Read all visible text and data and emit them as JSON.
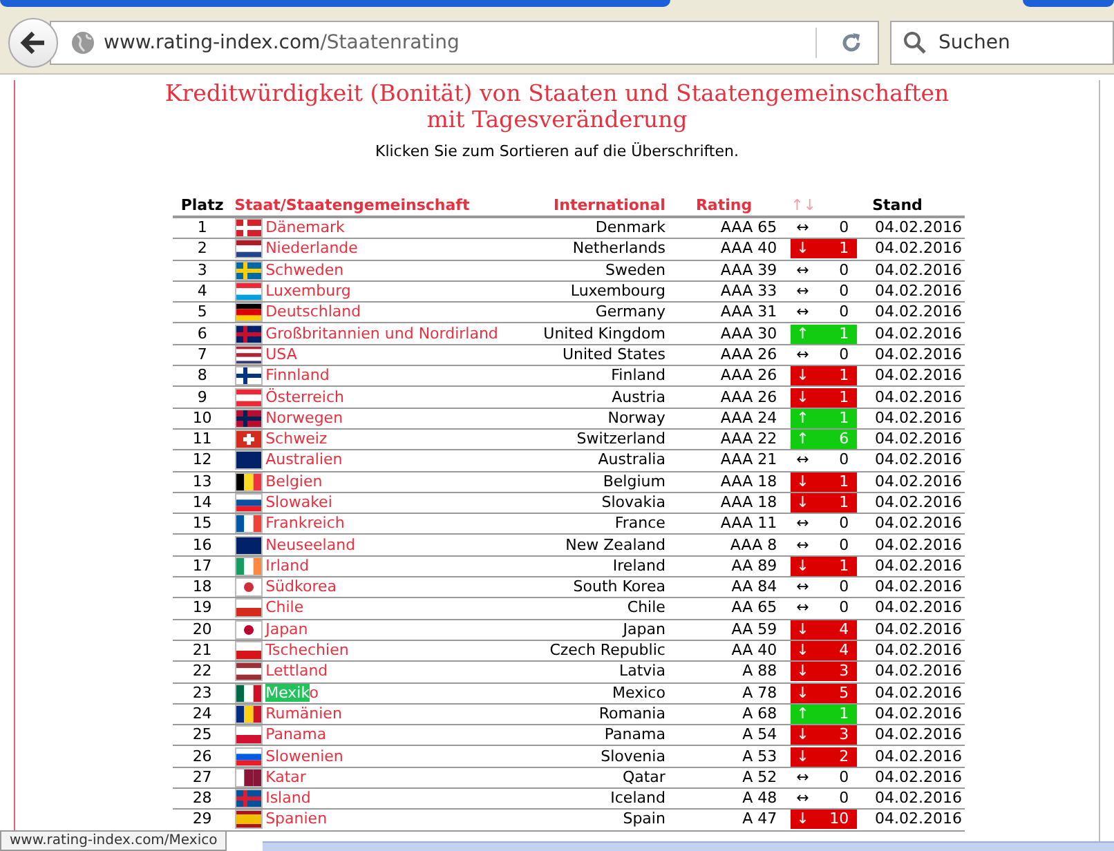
{
  "browser": {
    "url_host": "www.rating-index.com",
    "url_path": "/Staatenrating",
    "search_placeholder": "Suchen"
  },
  "page": {
    "title_line_1": "Kreditwürdigkeit (Bonität) von Staaten und Staatengemeinschaften",
    "title_line_2": "mit Tagesveränderung",
    "hint": "Klicken Sie zum Sortieren auf die Überschriften."
  },
  "table": {
    "columns": [
      "Platz",
      "Staat/Staatengemeinschaft",
      "International",
      "Rating",
      "↑↓",
      "Stand"
    ],
    "rows": [
      {
        "rank": "1",
        "name": "Dänemark",
        "international": "Denmark",
        "rating": "AAA 65",
        "kind": "same",
        "arrow": "↔",
        "change": "0",
        "date": "04.02.2016"
      },
      {
        "rank": "2",
        "name": "Niederlande",
        "international": "Netherlands",
        "rating": "AAA 40",
        "kind": "down",
        "arrow": "↓",
        "change": "1",
        "date": "04.02.2016"
      },
      {
        "rank": "3",
        "name": "Schweden",
        "international": "Sweden",
        "rating": "AAA 39",
        "kind": "same",
        "arrow": "↔",
        "change": "0",
        "date": "04.02.2016"
      },
      {
        "rank": "4",
        "name": "Luxemburg",
        "international": "Luxembourg",
        "rating": "AAA 33",
        "kind": "same",
        "arrow": "↔",
        "change": "0",
        "date": "04.02.2016"
      },
      {
        "rank": "5",
        "name": "Deutschland",
        "international": "Germany",
        "rating": "AAA 31",
        "kind": "same",
        "arrow": "↔",
        "change": "0",
        "date": "04.02.2016"
      },
      {
        "rank": "6",
        "name": "Großbritannien und Nordirland",
        "international": "United Kingdom",
        "rating": "AAA 30",
        "kind": "up",
        "arrow": "↑",
        "change": "1",
        "date": "04.02.2016"
      },
      {
        "rank": "7",
        "name": "USA",
        "international": "United States",
        "rating": "AAA 26",
        "kind": "same",
        "arrow": "↔",
        "change": "0",
        "date": "04.02.2016"
      },
      {
        "rank": "8",
        "name": "Finnland",
        "international": "Finland",
        "rating": "AAA 26",
        "kind": "down",
        "arrow": "↓",
        "change": "1",
        "date": "04.02.2016"
      },
      {
        "rank": "9",
        "name": "Österreich",
        "international": "Austria",
        "rating": "AAA 26",
        "kind": "down",
        "arrow": "↓",
        "change": "1",
        "date": "04.02.2016"
      },
      {
        "rank": "10",
        "name": "Norwegen",
        "international": "Norway",
        "rating": "AAA 24",
        "kind": "up",
        "arrow": "↑",
        "change": "1",
        "date": "04.02.2016"
      },
      {
        "rank": "11",
        "name": "Schweiz",
        "international": "Switzerland",
        "rating": "AAA 22",
        "kind": "up",
        "arrow": "↑",
        "change": "6",
        "date": "04.02.2016"
      },
      {
        "rank": "12",
        "name": "Australien",
        "international": "Australia",
        "rating": "AAA 21",
        "kind": "same",
        "arrow": "↔",
        "change": "0",
        "date": "04.02.2016"
      },
      {
        "rank": "13",
        "name": "Belgien",
        "international": "Belgium",
        "rating": "AAA 18",
        "kind": "down",
        "arrow": "↓",
        "change": "1",
        "date": "04.02.2016"
      },
      {
        "rank": "14",
        "name": "Slowakei",
        "international": "Slovakia",
        "rating": "AAA 18",
        "kind": "down",
        "arrow": "↓",
        "change": "1",
        "date": "04.02.2016"
      },
      {
        "rank": "15",
        "name": "Frankreich",
        "international": "France",
        "rating": "AAA 11",
        "kind": "same",
        "arrow": "↔",
        "change": "0",
        "date": "04.02.2016"
      },
      {
        "rank": "16",
        "name": "Neuseeland",
        "international": "New Zealand",
        "rating": "AAA 8",
        "kind": "same",
        "arrow": "↔",
        "change": "0",
        "date": "04.02.2016"
      },
      {
        "rank": "17",
        "name": "Irland",
        "international": "Ireland",
        "rating": "AA 89",
        "kind": "down",
        "arrow": "↓",
        "change": "1",
        "date": "04.02.2016"
      },
      {
        "rank": "18",
        "name": "Südkorea",
        "international": "South Korea",
        "rating": "AA 84",
        "kind": "same",
        "arrow": "↔",
        "change": "0",
        "date": "04.02.2016"
      },
      {
        "rank": "19",
        "name": "Chile",
        "international": "Chile",
        "rating": "AA 65",
        "kind": "same",
        "arrow": "↔",
        "change": "0",
        "date": "04.02.2016"
      },
      {
        "rank": "20",
        "name": "Japan",
        "international": "Japan",
        "rating": "AA 59",
        "kind": "down",
        "arrow": "↓",
        "change": "4",
        "date": "04.02.2016"
      },
      {
        "rank": "21",
        "name": "Tschechien",
        "international": "Czech Republic",
        "rating": "AA 40",
        "kind": "down",
        "arrow": "↓",
        "change": "4",
        "date": "04.02.2016"
      },
      {
        "rank": "22",
        "name": "Lettland",
        "international": "Latvia",
        "rating": "A 88",
        "kind": "down",
        "arrow": "↓",
        "change": "3",
        "date": "04.02.2016"
      },
      {
        "rank": "23",
        "highlighted": "Mexik",
        "name": "o",
        "international": "Mexico",
        "rating": "A 78",
        "kind": "down",
        "arrow": "↓",
        "change": "5",
        "date": "04.02.2016"
      },
      {
        "rank": "24",
        "name": "Rumänien",
        "international": "Romania",
        "rating": "A 68",
        "kind": "up",
        "arrow": "↑",
        "change": "1",
        "date": "04.02.2016"
      },
      {
        "rank": "25",
        "name": "Panama",
        "international": "Panama",
        "rating": "A 54",
        "kind": "down",
        "arrow": "↓",
        "change": "3",
        "date": "04.02.2016"
      },
      {
        "rank": "26",
        "name": "Slowenien",
        "international": "Slovenia",
        "rating": "A 53",
        "kind": "down",
        "arrow": "↓",
        "change": "2",
        "date": "04.02.2016"
      },
      {
        "rank": "27",
        "name": "Katar",
        "international": "Qatar",
        "rating": "A 52",
        "kind": "same",
        "arrow": "↔",
        "change": "0",
        "date": "04.02.2016"
      },
      {
        "rank": "28",
        "name": "Island",
        "international": "Iceland",
        "rating": "A 48",
        "kind": "same",
        "arrow": "↔",
        "change": "0",
        "date": "04.02.2016"
      },
      {
        "rank": "29",
        "name": "Spanien",
        "international": "Spain",
        "rating": "A 47",
        "kind": "down",
        "arrow": "↓",
        "change": "10",
        "date": "04.02.2016"
      }
    ]
  },
  "status_bar": {
    "link": "www.rating-index.com/Mexico"
  }
}
